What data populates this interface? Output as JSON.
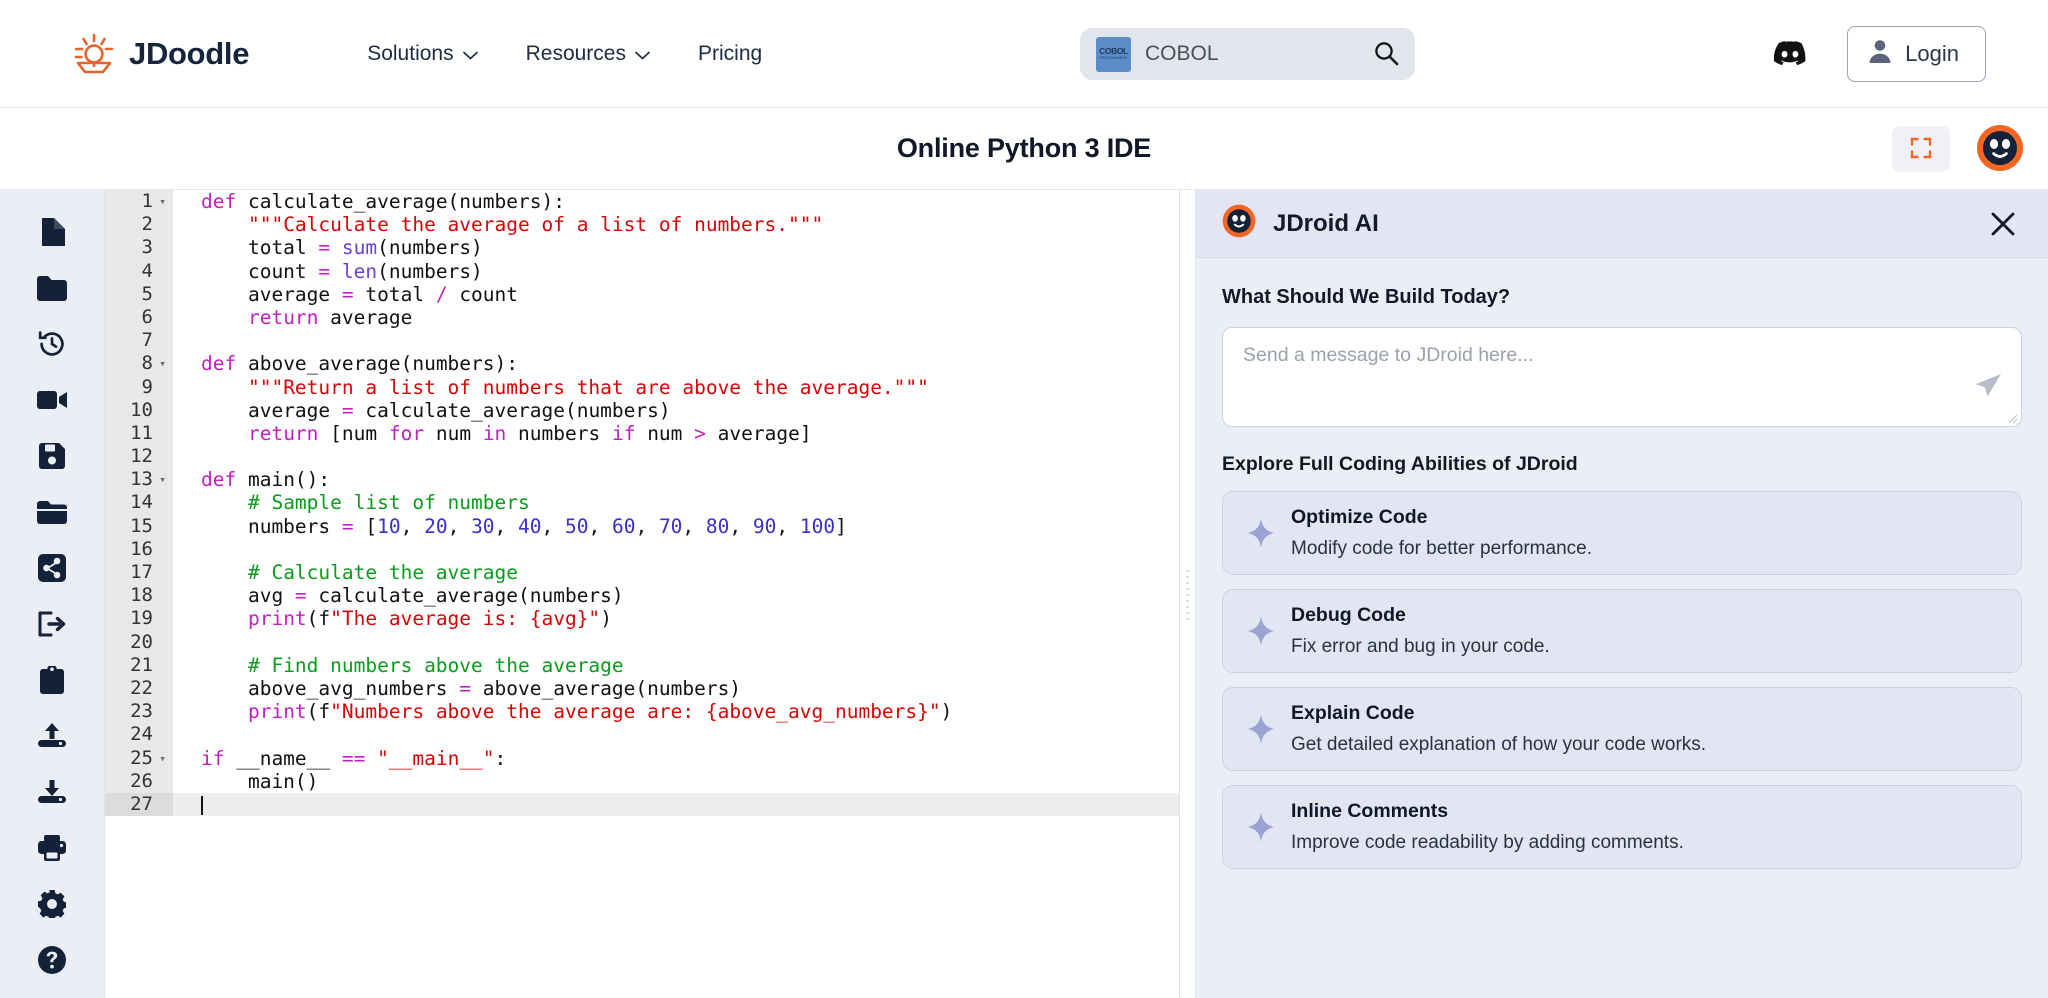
{
  "topnav": {
    "brand": {
      "name": "JDoodle",
      "logo_icon": "sun-bulb-logo-icon",
      "accent": "#e8622c"
    },
    "links": [
      {
        "label": "Solutions",
        "has_dropdown": true
      },
      {
        "label": "Resources",
        "has_dropdown": true
      },
      {
        "label": "Pricing",
        "has_dropdown": false
      }
    ],
    "search": {
      "value": "COBOL",
      "chip_label": "COBOL",
      "chip_sub": "PROGRAMMING",
      "chip_color": "#5b8dc8",
      "search_icon": "magnifier-icon"
    },
    "discord_icon": "discord-icon",
    "login": {
      "label": "Login",
      "icon": "user-avatar-icon"
    }
  },
  "idebar": {
    "title": "Online Python 3 IDE",
    "fullscreen_icon": "fullscreen-expand-icon",
    "assistant_avatar_icon": "jdroid-face-icon"
  },
  "toolstrip": {
    "items": [
      {
        "name": "new-file",
        "icon": "file-icon"
      },
      {
        "name": "new-folder",
        "icon": "folder-icon"
      },
      {
        "name": "history",
        "icon": "history-clock-icon"
      },
      {
        "name": "record-video",
        "icon": "video-camera-icon"
      },
      {
        "name": "save",
        "icon": "floppy-save-icon"
      },
      {
        "name": "open-project",
        "icon": "open-folder-icon"
      },
      {
        "name": "share",
        "icon": "share-nodes-icon"
      },
      {
        "name": "export",
        "icon": "export-arrow-icon"
      },
      {
        "name": "clipboard",
        "icon": "clipboard-icon"
      },
      {
        "name": "upload",
        "icon": "upload-arrow-icon"
      },
      {
        "name": "download",
        "icon": "download-arrow-icon"
      },
      {
        "name": "print",
        "icon": "printer-icon"
      },
      {
        "name": "settings",
        "icon": "gear-icon"
      },
      {
        "name": "help",
        "icon": "question-circle-icon"
      }
    ]
  },
  "editor": {
    "language": "Python 3",
    "active_line": 27,
    "total_lines": 27,
    "lines": [
      {
        "n": 1,
        "fold": true,
        "tokens": [
          [
            "kr",
            "def"
          ],
          [
            "p",
            " calculate_average(numbers):"
          ]
        ]
      },
      {
        "n": 2,
        "fold": false,
        "tokens": [
          [
            "p",
            "    "
          ],
          [
            "s",
            "\"\"\"Calculate the average of a list of numbers.\"\"\""
          ]
        ]
      },
      {
        "n": 3,
        "fold": false,
        "tokens": [
          [
            "p",
            "    total "
          ],
          [
            "o",
            "="
          ],
          [
            "p",
            " "
          ],
          [
            "b",
            "sum"
          ],
          [
            "p",
            "(numbers)"
          ]
        ]
      },
      {
        "n": 4,
        "fold": false,
        "tokens": [
          [
            "p",
            "    count "
          ],
          [
            "o",
            "="
          ],
          [
            "p",
            " "
          ],
          [
            "b",
            "len"
          ],
          [
            "p",
            "(numbers)"
          ]
        ]
      },
      {
        "n": 5,
        "fold": false,
        "tokens": [
          [
            "p",
            "    average "
          ],
          [
            "o",
            "="
          ],
          [
            "p",
            " total "
          ],
          [
            "o",
            "/"
          ],
          [
            "p",
            " count"
          ]
        ]
      },
      {
        "n": 6,
        "fold": false,
        "tokens": [
          [
            "p",
            "    "
          ],
          [
            "kr",
            "return"
          ],
          [
            "p",
            " average"
          ]
        ]
      },
      {
        "n": 7,
        "fold": false,
        "tokens": [
          [
            "p",
            ""
          ]
        ]
      },
      {
        "n": 8,
        "fold": true,
        "tokens": [
          [
            "kr",
            "def"
          ],
          [
            "p",
            " above_average(numbers):"
          ]
        ]
      },
      {
        "n": 9,
        "fold": false,
        "tokens": [
          [
            "p",
            "    "
          ],
          [
            "s",
            "\"\"\"Return a list of numbers that are above the average.\"\"\""
          ]
        ]
      },
      {
        "n": 10,
        "fold": false,
        "tokens": [
          [
            "p",
            "    average "
          ],
          [
            "o",
            "="
          ],
          [
            "p",
            " calculate_average(numbers)"
          ]
        ]
      },
      {
        "n": 11,
        "fold": false,
        "tokens": [
          [
            "p",
            "    "
          ],
          [
            "kr",
            "return"
          ],
          [
            "p",
            " [num "
          ],
          [
            "k",
            "for"
          ],
          [
            "p",
            " num "
          ],
          [
            "k",
            "in"
          ],
          [
            "p",
            " numbers "
          ],
          [
            "k",
            "if"
          ],
          [
            "p",
            " num "
          ],
          [
            "o",
            ">"
          ],
          [
            "p",
            " average]"
          ]
        ]
      },
      {
        "n": 12,
        "fold": false,
        "tokens": [
          [
            "p",
            ""
          ]
        ]
      },
      {
        "n": 13,
        "fold": true,
        "tokens": [
          [
            "kr",
            "def"
          ],
          [
            "p",
            " main():"
          ]
        ]
      },
      {
        "n": 14,
        "fold": false,
        "tokens": [
          [
            "p",
            "    "
          ],
          [
            "c",
            "# Sample list of numbers"
          ]
        ]
      },
      {
        "n": 15,
        "fold": false,
        "tokens": [
          [
            "p",
            "    numbers "
          ],
          [
            "o",
            "="
          ],
          [
            "p",
            " ["
          ],
          [
            "n",
            "10"
          ],
          [
            "p",
            ", "
          ],
          [
            "n",
            "20"
          ],
          [
            "p",
            ", "
          ],
          [
            "n",
            "30"
          ],
          [
            "p",
            ", "
          ],
          [
            "n",
            "40"
          ],
          [
            "p",
            ", "
          ],
          [
            "n",
            "50"
          ],
          [
            "p",
            ", "
          ],
          [
            "n",
            "60"
          ],
          [
            "p",
            ", "
          ],
          [
            "n",
            "70"
          ],
          [
            "p",
            ", "
          ],
          [
            "n",
            "80"
          ],
          [
            "p",
            ", "
          ],
          [
            "n",
            "90"
          ],
          [
            "p",
            ", "
          ],
          [
            "n",
            "100"
          ],
          [
            "p",
            "]"
          ]
        ]
      },
      {
        "n": 16,
        "fold": false,
        "tokens": [
          [
            "p",
            ""
          ]
        ]
      },
      {
        "n": 17,
        "fold": false,
        "tokens": [
          [
            "p",
            "    "
          ],
          [
            "c",
            "# Calculate the average"
          ]
        ]
      },
      {
        "n": 18,
        "fold": false,
        "tokens": [
          [
            "p",
            "    avg "
          ],
          [
            "o",
            "="
          ],
          [
            "p",
            " calculate_average(numbers)"
          ]
        ]
      },
      {
        "n": 19,
        "fold": false,
        "tokens": [
          [
            "p",
            "    "
          ],
          [
            "k",
            "print"
          ],
          [
            "p",
            "(f"
          ],
          [
            "s",
            "\"The average is: {avg}\""
          ],
          [
            "p",
            ")"
          ]
        ]
      },
      {
        "n": 20,
        "fold": false,
        "tokens": [
          [
            "p",
            ""
          ]
        ]
      },
      {
        "n": 21,
        "fold": false,
        "tokens": [
          [
            "p",
            "    "
          ],
          [
            "c",
            "# Find numbers above the average"
          ]
        ]
      },
      {
        "n": 22,
        "fold": false,
        "tokens": [
          [
            "p",
            "    above_avg_numbers "
          ],
          [
            "o",
            "="
          ],
          [
            "p",
            " above_average(numbers)"
          ]
        ]
      },
      {
        "n": 23,
        "fold": false,
        "tokens": [
          [
            "p",
            "    "
          ],
          [
            "k",
            "print"
          ],
          [
            "p",
            "(f"
          ],
          [
            "s",
            "\"Numbers above the average are: {above_avg_numbers}\""
          ],
          [
            "p",
            ")"
          ]
        ]
      },
      {
        "n": 24,
        "fold": false,
        "tokens": [
          [
            "p",
            ""
          ]
        ]
      },
      {
        "n": 25,
        "fold": true,
        "tokens": [
          [
            "k",
            "if"
          ],
          [
            "p",
            " __name__ "
          ],
          [
            "o",
            "=="
          ],
          [
            "p",
            " "
          ],
          [
            "s",
            "\"__main__\""
          ],
          [
            "p",
            ":"
          ]
        ]
      },
      {
        "n": 26,
        "fold": false,
        "tokens": [
          [
            "p",
            "    main()"
          ]
        ]
      },
      {
        "n": 27,
        "fold": false,
        "tokens": [
          [
            "p",
            ""
          ]
        ]
      }
    ]
  },
  "jdroid": {
    "header_title": "JDroid AI",
    "avatar_icon": "jdroid-face-icon",
    "close_icon": "close-x-icon",
    "prompt_heading": "What Should We Build Today?",
    "composer_placeholder": "Send a message to JDroid here...",
    "composer_value": "",
    "send_icon": "send-paper-plane-icon",
    "abilities_heading": "Explore Full Coding Abilities of JDroid",
    "cards": [
      {
        "title": "Optimize Code",
        "desc": "Modify code for better performance.",
        "icon": "sparkle-icon"
      },
      {
        "title": "Debug Code",
        "desc": "Fix error and bug in your code.",
        "icon": "sparkle-icon"
      },
      {
        "title": "Explain Code",
        "desc": "Get detailed explanation of how your code works.",
        "icon": "sparkle-icon"
      },
      {
        "title": "Inline Comments",
        "desc": "Improve code readability by adding comments.",
        "icon": "sparkle-icon"
      }
    ]
  }
}
